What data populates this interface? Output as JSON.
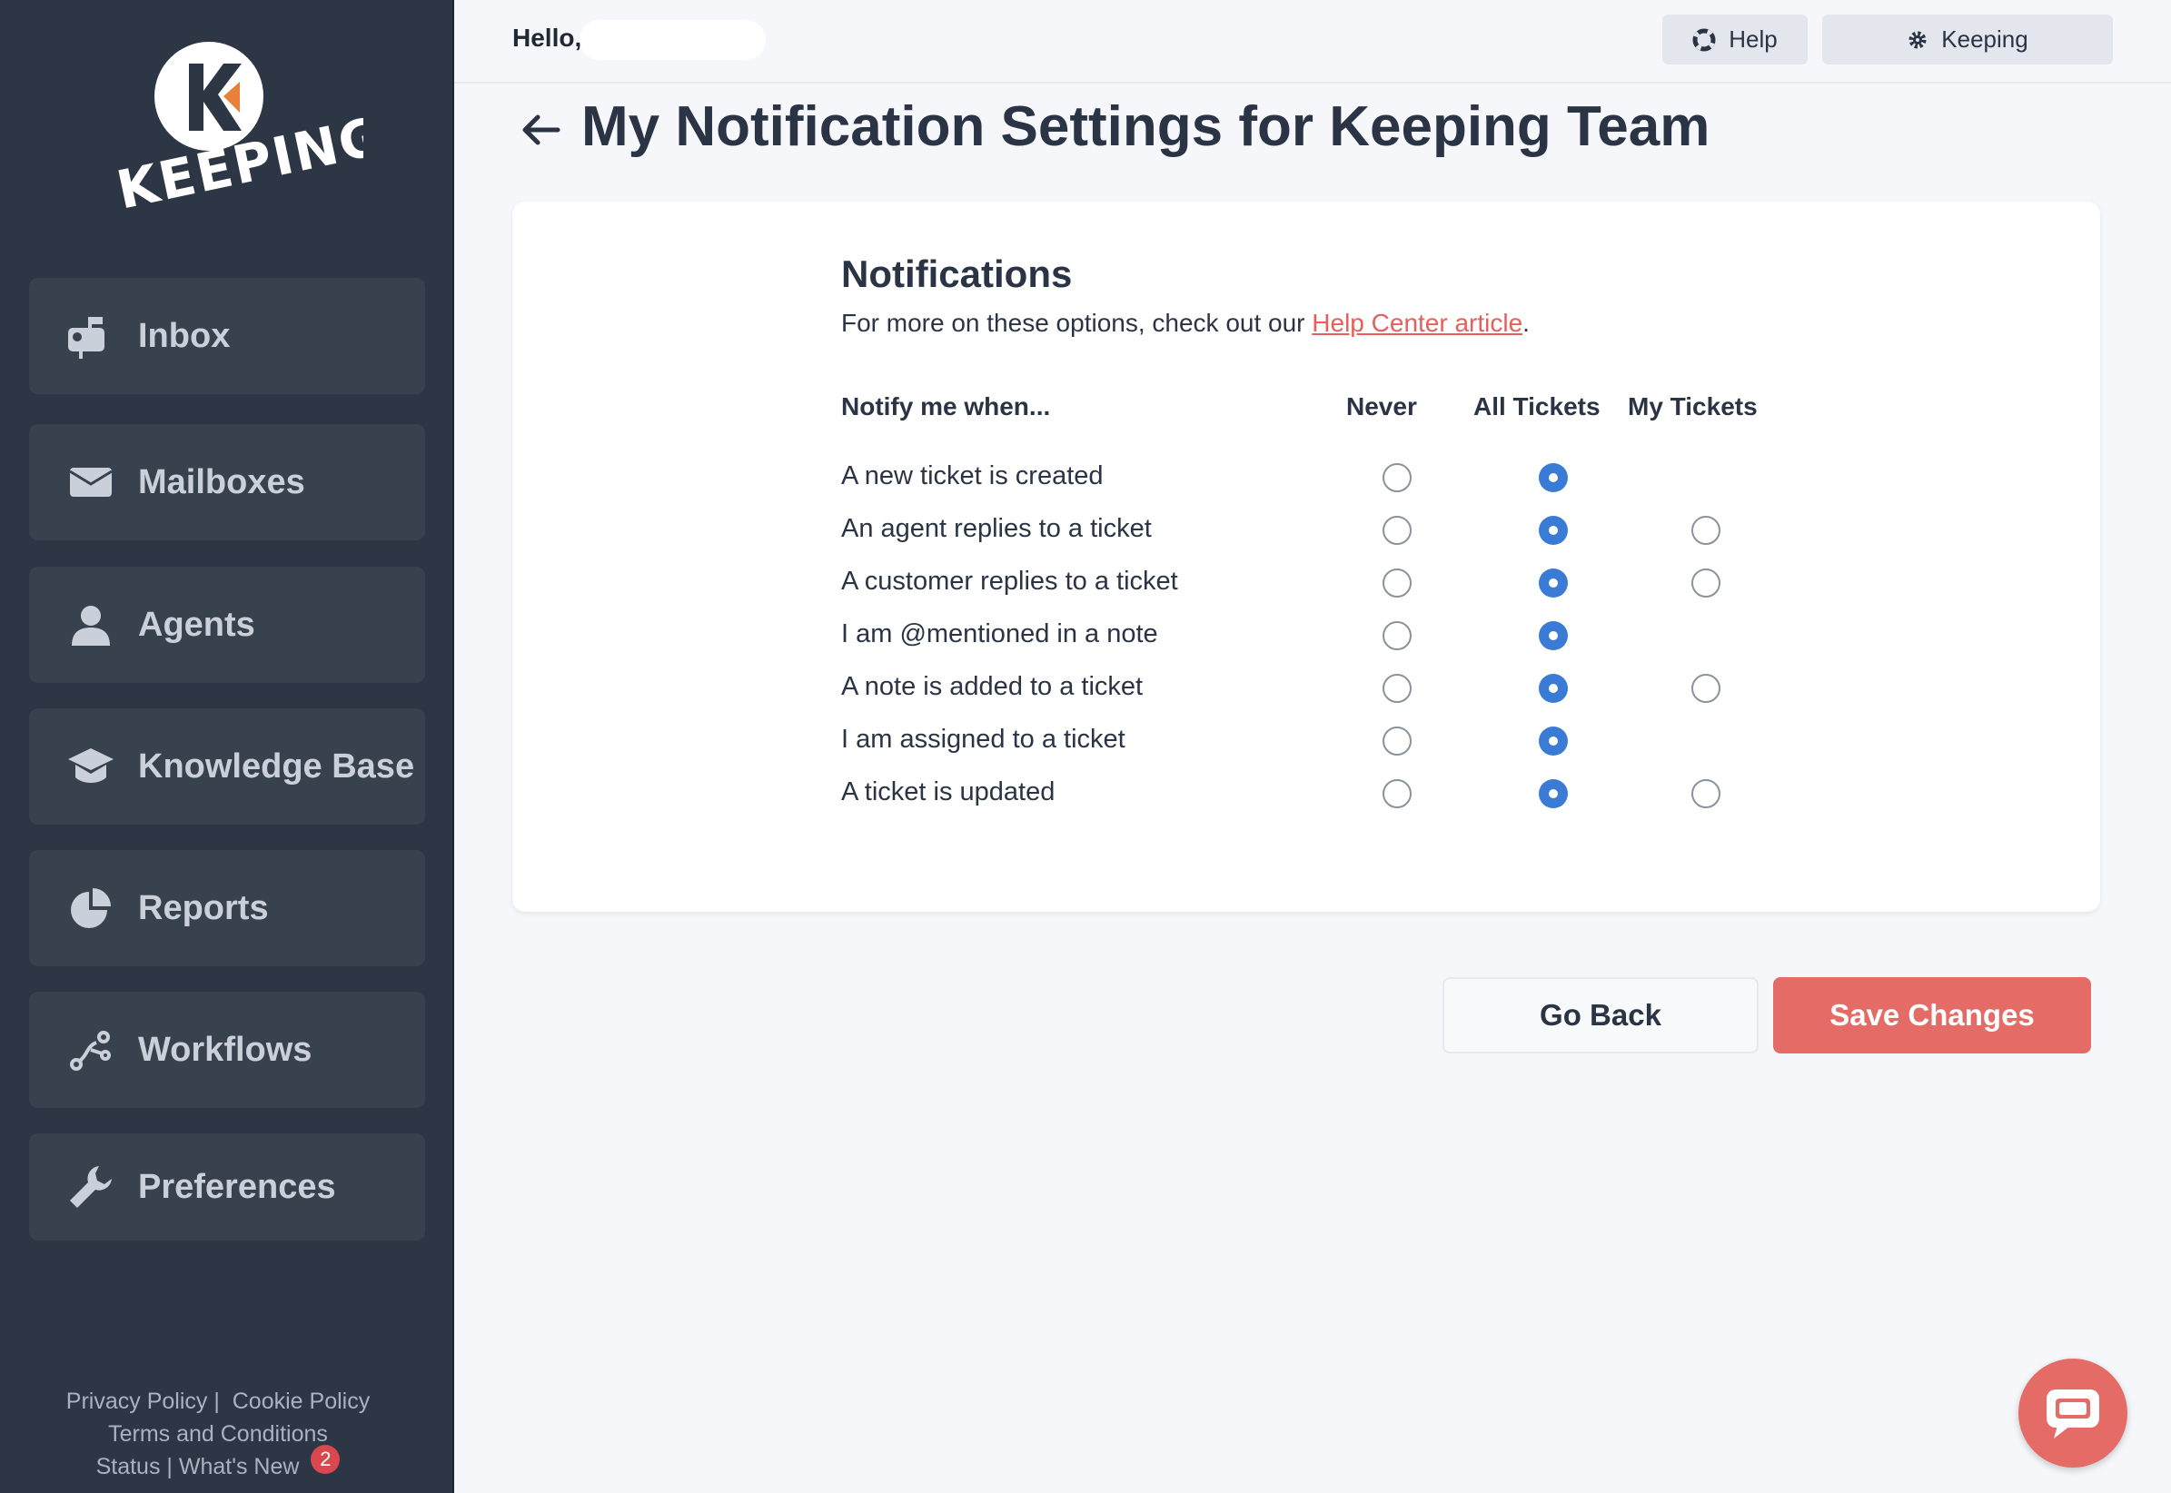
{
  "brand": {
    "logo_text": "KEEPING"
  },
  "sidebar": {
    "items": [
      {
        "label": "Inbox",
        "icon": "mailbox-icon"
      },
      {
        "label": "Mailboxes",
        "icon": "envelope-icon"
      },
      {
        "label": "Agents",
        "icon": "user-icon"
      },
      {
        "label": "Knowledge Base",
        "icon": "graduation-cap-icon"
      },
      {
        "label": "Reports",
        "icon": "pie-chart-icon"
      },
      {
        "label": "Workflows",
        "icon": "workflow-icon"
      },
      {
        "label": "Preferences",
        "icon": "wrench-icon"
      }
    ],
    "footer": {
      "privacy": "Privacy Policy",
      "sep1": "|",
      "cookie": "Cookie Policy",
      "terms": "Terms and Conditions",
      "status": "Status",
      "sep2": "|",
      "whats_new": "What's New",
      "whats_new_count": "2"
    }
  },
  "topbar": {
    "greeting": "Hello,",
    "help_label": "Help",
    "account_label": "Keeping"
  },
  "page": {
    "title": "My Notification Settings for Keeping Team"
  },
  "notifications": {
    "title": "Notifications",
    "subtitle_prefix": "For more on these options, check out our ",
    "subtitle_link": "Help Center article",
    "subtitle_suffix": ".",
    "columns": {
      "event": "Notify me when...",
      "never": "Never",
      "all": "All Tickets",
      "mine": "My Tickets"
    },
    "rows": [
      {
        "label": "A new ticket is created",
        "selected": "all",
        "has_mine": false
      },
      {
        "label": "An agent replies to a ticket",
        "selected": "all",
        "has_mine": true
      },
      {
        "label": "A customer replies to a ticket",
        "selected": "all",
        "has_mine": true
      },
      {
        "label": "I am @mentioned in a note",
        "selected": "all",
        "has_mine": false
      },
      {
        "label": "A note is added to a ticket",
        "selected": "all",
        "has_mine": true
      },
      {
        "label": "I am assigned to a ticket",
        "selected": "all",
        "has_mine": false
      },
      {
        "label": "A ticket is updated",
        "selected": "all",
        "has_mine": true
      }
    ]
  },
  "actions": {
    "go_back": "Go Back",
    "save": "Save Changes"
  },
  "colors": {
    "sidebar_bg": "#2d3645",
    "accent": "#e56c66",
    "radio_selected": "#3a7bd5"
  }
}
